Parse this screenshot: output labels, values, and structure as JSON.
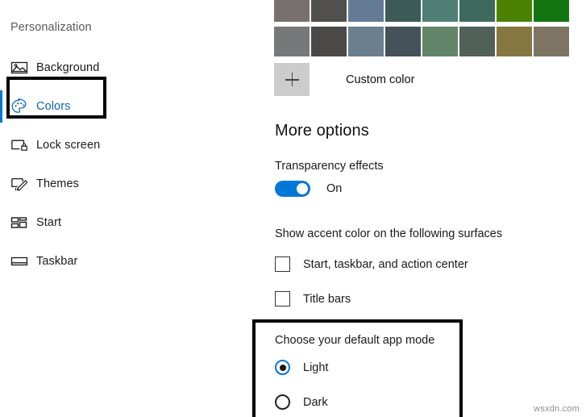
{
  "sidebar": {
    "title": "Personalization",
    "items": [
      {
        "label": "Background",
        "icon": "image-icon",
        "selected": false
      },
      {
        "label": "Colors",
        "icon": "color-palette-icon",
        "selected": true
      },
      {
        "label": "Lock screen",
        "icon": "lock-screen-icon",
        "selected": false
      },
      {
        "label": "Themes",
        "icon": "themes-brush-icon",
        "selected": false
      },
      {
        "label": "Start",
        "icon": "start-tiles-icon",
        "selected": false
      },
      {
        "label": "Taskbar",
        "icon": "taskbar-icon",
        "selected": false
      }
    ]
  },
  "accent_colors": {
    "row_top": [
      "#77706f",
      "#51504e",
      "#647b95",
      "#3c5b56",
      "#4f7e74",
      "#3e6a5d",
      "#4a8200",
      "#137412"
    ],
    "row_bottom": [
      "#777879",
      "#4a4947",
      "#6b7f8e",
      "#44525a",
      "#628468",
      "#52605a",
      "#867640",
      "#7e7463"
    ]
  },
  "custom_color": {
    "label": "Custom color",
    "icon": "plus-icon",
    "button_color": "#cccccc"
  },
  "more_options": {
    "heading": "More options",
    "transparency": {
      "label": "Transparency effects",
      "state_label": "On",
      "on": true,
      "accent": "#0078d7"
    },
    "accent_surfaces": {
      "label": "Show accent color on the following surfaces",
      "checkboxes": [
        {
          "label": "Start, taskbar, and action center",
          "checked": false
        },
        {
          "label": "Title bars",
          "checked": false
        }
      ]
    },
    "app_mode": {
      "title": "Choose your default app mode",
      "options": [
        {
          "label": "Light",
          "selected": true
        },
        {
          "label": "Dark",
          "selected": false
        }
      ],
      "highlighted": true
    }
  },
  "watermark": {
    "text": "wsxdn.com"
  }
}
